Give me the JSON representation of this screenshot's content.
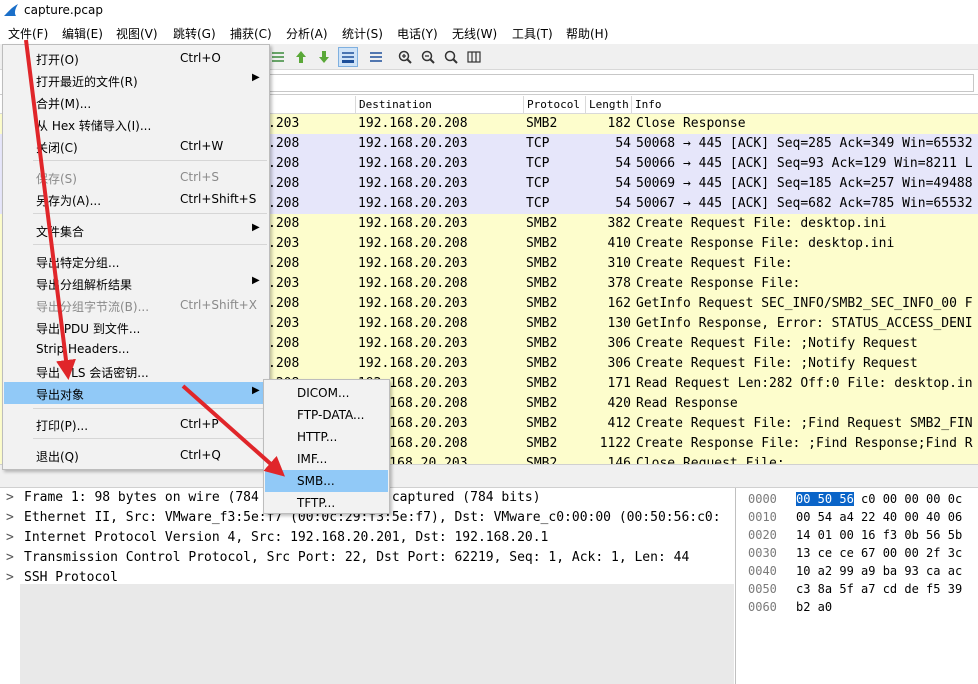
{
  "window": {
    "title": "capture.pcap"
  },
  "menubar": [
    "文件(F)",
    "编辑(E)",
    "视图(V)",
    "跳转(G)",
    "捕获(C)",
    "分析(A)",
    "统计(S)",
    "电话(Y)",
    "无线(W)",
    "工具(T)",
    "帮助(H)"
  ],
  "columns": {
    "destination": "Destination",
    "protocol": "Protocol",
    "length": "Length",
    "info": "Info"
  },
  "colors": {
    "smb": "#fdfdcc",
    "tcp": "#e6e6fa",
    "menu_highlight": "#91c9f7",
    "arrow": "#e0262a"
  },
  "packets": [
    {
      "src": ".203",
      "dst": "192.168.20.208",
      "proto": "SMB2",
      "len": "182",
      "info": "Close Response"
    },
    {
      "src": ".208",
      "dst": "192.168.20.203",
      "proto": "TCP",
      "len": "54",
      "info": "50068 → 445 [ACK] Seq=285 Ack=349 Win=65532"
    },
    {
      "src": ".208",
      "dst": "192.168.20.203",
      "proto": "TCP",
      "len": "54",
      "info": "50066 → 445 [ACK] Seq=93 Ack=129 Win=8211 L"
    },
    {
      "src": ".208",
      "dst": "192.168.20.203",
      "proto": "TCP",
      "len": "54",
      "info": "50069 → 445 [ACK] Seq=185 Ack=257 Win=49488"
    },
    {
      "src": ".208",
      "dst": "192.168.20.203",
      "proto": "TCP",
      "len": "54",
      "info": "50067 → 445 [ACK] Seq=682 Ack=785 Win=65532"
    },
    {
      "src": ".208",
      "dst": "192.168.20.203",
      "proto": "SMB2",
      "len": "382",
      "info": "Create Request File: desktop.ini"
    },
    {
      "src": ".203",
      "dst": "192.168.20.208",
      "proto": "SMB2",
      "len": "410",
      "info": "Create Response File: desktop.ini"
    },
    {
      "src": ".208",
      "dst": "192.168.20.203",
      "proto": "SMB2",
      "len": "310",
      "info": "Create Request File:"
    },
    {
      "src": ".203",
      "dst": "192.168.20.208",
      "proto": "SMB2",
      "len": "378",
      "info": "Create Response File:"
    },
    {
      "src": ".208",
      "dst": "192.168.20.203",
      "proto": "SMB2",
      "len": "162",
      "info": "GetInfo Request SEC_INFO/SMB2_SEC_INFO_00 F"
    },
    {
      "src": ".203",
      "dst": "192.168.20.208",
      "proto": "SMB2",
      "len": "130",
      "info": "GetInfo Response, Error: STATUS_ACCESS_DENI"
    },
    {
      "src": ".208",
      "dst": "192.168.20.203",
      "proto": "SMB2",
      "len": "306",
      "info": "Create Request File: ;Notify Request"
    },
    {
      "src": ".208",
      "dst": "192.168.20.203",
      "proto": "SMB2",
      "len": "306",
      "info": "Create Request File: ;Notify Request"
    },
    {
      "src": ".208",
      "dst": "192.168.20.203",
      "proto": "SMB2",
      "len": "171",
      "info": "Read Request Len:282 Off:0 File: desktop.in"
    },
    {
      "src": ".203",
      "dst": "192.168.20.208",
      "proto": "SMB2",
      "len": "420",
      "info": "Read Response"
    },
    {
      "src": ".208",
      "dst": "192.168.20.203",
      "proto": "SMB2",
      "len": "412",
      "info": "Create Request File: ;Find Request SMB2_FIN"
    },
    {
      "src": ".203",
      "dst": "192.168.20.208",
      "proto": "SMB2",
      "len": "1122",
      "info": "Create Response File: ;Find Response;Find R"
    },
    {
      "src": ".203",
      "dst": "192.168.20.203",
      "proto": "SMB2",
      "len": "146",
      "info": "Close Request File:"
    }
  ],
  "details": [
    "Frame 1: 98 bytes on wire (784 bits), 98 bytes captured (784 bits)",
    "Ethernet II, Src: VMware_f3:5e:f7 (00:0c:29:f3:5e:f7), Dst: VMware_c0:00:00 (00:50:56:c0:",
    "Internet Protocol Version 4, Src: 192.168.20.201, Dst: 192.168.20.1",
    "Transmission Control Protocol, Src Port: 22, Dst Port: 62219, Seq: 1, Ack: 1, Len: 44",
    "SSH Protocol"
  ],
  "bytes": [
    {
      "offset": "0000",
      "sel": "00 50 56",
      "rest": " c0 00 00 00 0c"
    },
    {
      "offset": "0010",
      "sel": "",
      "rest": "00 54 a4 22 40 00 40 06"
    },
    {
      "offset": "0020",
      "sel": "",
      "rest": "14 01 00 16 f3 0b 56 5b"
    },
    {
      "offset": "0030",
      "sel": "",
      "rest": "13 ce ce 67 00 00 2f 3c"
    },
    {
      "offset": "0040",
      "sel": "",
      "rest": "10 a2 99 a9 ba 93 ca ac"
    },
    {
      "offset": "0050",
      "sel": "",
      "rest": "c3 8a 5f a7 cd de f5 39"
    },
    {
      "offset": "0060",
      "sel": "",
      "rest": "b2 a0"
    }
  ],
  "file_menu": {
    "open": {
      "label": "打开(O)",
      "shortcut": "Ctrl+O"
    },
    "open_recent": {
      "label": "打开最近的文件(R)"
    },
    "merge": {
      "label": "合并(M)..."
    },
    "import_hex": {
      "label": "从 Hex 转储导入(I)..."
    },
    "close": {
      "label": "关闭(C)",
      "shortcut": "Ctrl+W"
    },
    "save": {
      "label": "保存(S)",
      "shortcut": "Ctrl+S"
    },
    "save_as": {
      "label": "另存为(A)...",
      "shortcut": "Ctrl+Shift+S"
    },
    "file_set": {
      "label": "文件集合"
    },
    "export_specified": {
      "label": "导出特定分组..."
    },
    "export_dissections": {
      "label": "导出分组解析结果"
    },
    "export_bytes": {
      "label": "导出分组字节流(B)...",
      "shortcut": "Ctrl+Shift+X"
    },
    "export_pdu": {
      "label": "导出 PDU 到文件..."
    },
    "strip_headers": {
      "label": "Strip Headers..."
    },
    "export_tls": {
      "label": "导出 TLS 会话密钥..."
    },
    "export_objects": {
      "label": "导出对象"
    },
    "print": {
      "label": "打印(P)...",
      "shortcut": "Ctrl+P"
    },
    "quit": {
      "label": "退出(Q)",
      "shortcut": "Ctrl+Q"
    }
  },
  "export_submenu": [
    "DICOM...",
    "FTP-DATA...",
    "HTTP...",
    "IMF...",
    "SMB...",
    "TFTP..."
  ]
}
